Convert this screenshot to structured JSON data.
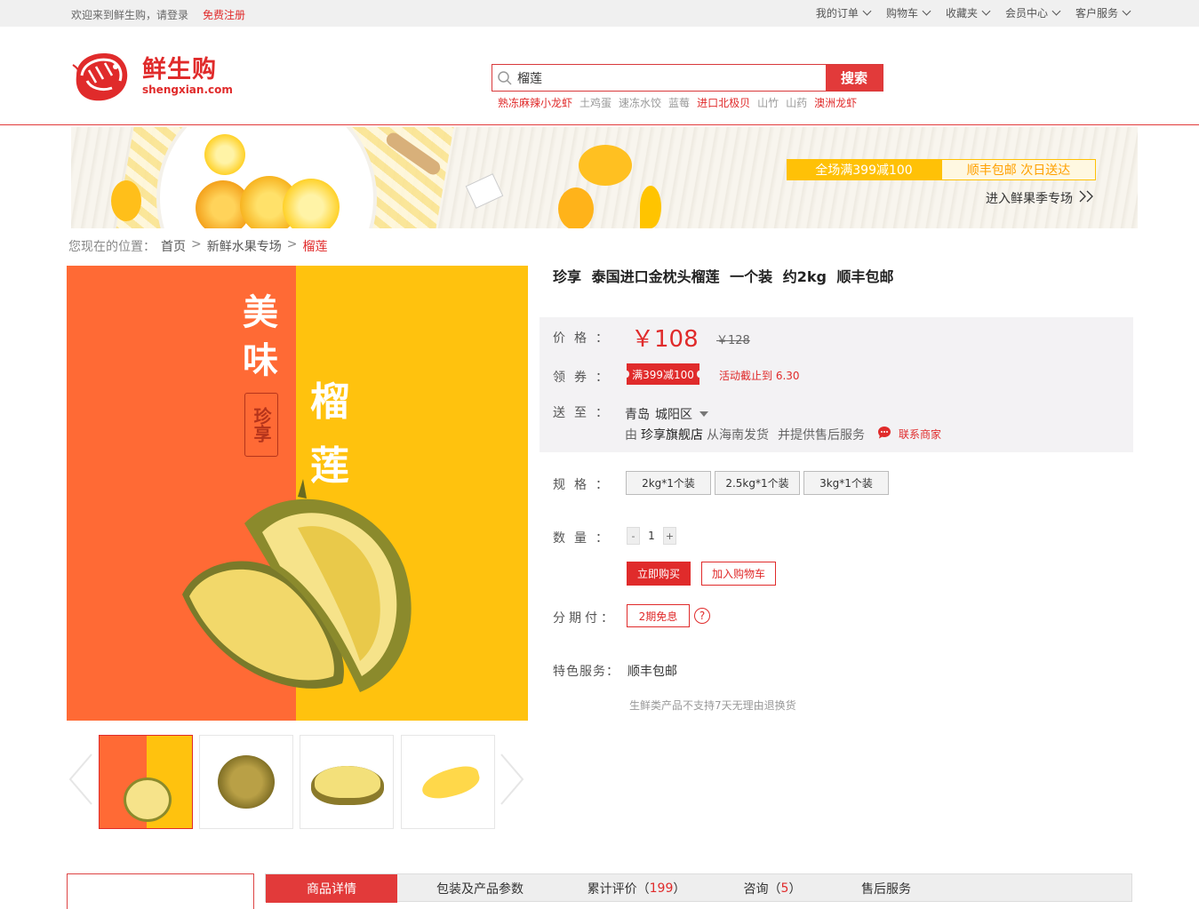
{
  "topbar": {
    "welcome": "欢迎来到鲜生购，请登录",
    "register": "免费注册",
    "menu": [
      {
        "label": "我的订单"
      },
      {
        "label": "购物车"
      },
      {
        "label": "收藏夹"
      },
      {
        "label": "会员中心"
      },
      {
        "label": "客户服务"
      }
    ]
  },
  "logo": {
    "cn": "鲜生购",
    "en": "shengxian.com"
  },
  "search": {
    "value": "榴莲",
    "button": "搜索"
  },
  "hotwords": [
    {
      "text": "熟冻麻辣小龙虾",
      "red": true
    },
    {
      "text": "土鸡蛋",
      "red": false
    },
    {
      "text": "速冻水饺",
      "red": false
    },
    {
      "text": "蓝莓",
      "red": false
    },
    {
      "text": "进口北极贝",
      "red": true
    },
    {
      "text": "山竹",
      "red": false
    },
    {
      "text": "山药",
      "red": false
    },
    {
      "text": "澳洲龙虾",
      "red": true
    }
  ],
  "banner": {
    "promo": "全场满399减100",
    "shipping": "顺丰包邮  次日送达",
    "enter": "进入鲜果季专场"
  },
  "breadcrumb": {
    "prefix": "您现在的位置：",
    "home": "首页",
    "category": "新鲜水果专场",
    "current": "榴莲",
    "sep": ">"
  },
  "main_image": {
    "text1": "美味",
    "seal": "珍享",
    "text2": "榴莲"
  },
  "product": {
    "title": "珍享  泰国进口金枕头榴莲  一个装  约2kg  顺丰包邮",
    "price_label": "价格：",
    "price": "￥108",
    "old_price": "￥128",
    "coupon_label": "领券：",
    "coupon": "满399减100",
    "deadline": "活动截止到  6.30",
    "ship_label": "送至：",
    "region_city": "青岛",
    "region_district": "城阳区",
    "ship_from": "由",
    "store": "珍享旗舰店",
    "ship_origin": "从海南发货",
    "after_sale": "并提供售后服务",
    "contact": "联系商家",
    "spec_label": "规格：",
    "specs": [
      "2kg*1个装",
      "2.5kg*1个装",
      "3kg*1个装"
    ],
    "qty_label": "数量：",
    "qty_minus": "-",
    "qty_value": "1",
    "qty_plus": "+",
    "buy_now": "立即购买",
    "add_cart": "加入购物车",
    "install_label": "分期付：",
    "install": "2期免息",
    "install_help": "?",
    "service_label": "特色服务：",
    "service": "顺丰包邮",
    "notice": "生鲜类产品不支持7天无理由退换货"
  },
  "tabs": [
    {
      "label": "商品详情",
      "count": "",
      "active": true
    },
    {
      "label": "包装及产品参数",
      "count": "",
      "active": false
    },
    {
      "label": "累计评价",
      "count": "199",
      "active": false
    },
    {
      "label": "咨询",
      "count": "5",
      "active": false
    },
    {
      "label": "售后服务",
      "count": "",
      "active": false
    }
  ],
  "colors": {
    "brand": "#e02b2b",
    "accent_yellow": "#ffc20e",
    "accent_orange": "#ff6a35"
  }
}
